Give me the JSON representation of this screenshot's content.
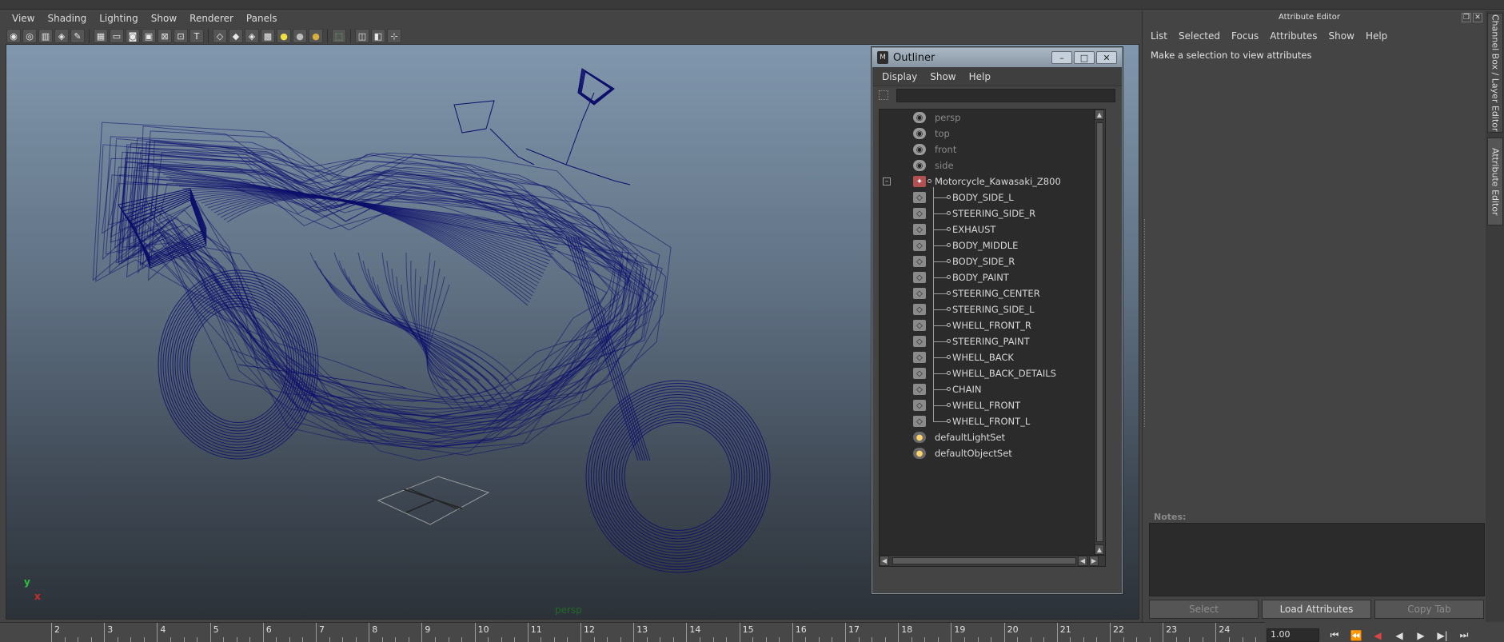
{
  "viewport": {
    "menu": [
      "View",
      "Shading",
      "Lighting",
      "Show",
      "Renderer",
      "Panels"
    ],
    "camera_label": "persp",
    "axis_y": "y",
    "axis_x": "x",
    "wireframe_color": "#0d0f6b"
  },
  "outliner": {
    "title": "Outliner",
    "window_buttons": [
      "–",
      "□",
      "✕"
    ],
    "menu": [
      "Display",
      "Show",
      "Help"
    ],
    "cameras": [
      "persp",
      "top",
      "front",
      "side"
    ],
    "group": "Motorcycle_Kawasaki_Z800",
    "group_expander": "–",
    "children": [
      "BODY_SIDE_L",
      "STEERING_SIDE_R",
      "EXHAUST",
      "BODY_MIDDLE",
      "BODY_SIDE_R",
      "BODY_PAINT",
      "STEERING_CENTER",
      "STEERING_SIDE_L",
      "WHELL_FRONT_R",
      "STEERING_PAINT",
      "WHELL_BACK",
      "WHELL_BACK_DETAILS",
      "CHAIN",
      "WHELL_FRONT",
      "WHELL_FRONT_L"
    ],
    "sets": [
      "defaultLightSet",
      "defaultObjectSet"
    ]
  },
  "attribute_editor": {
    "title": "Attribute Editor",
    "menu": [
      "List",
      "Selected",
      "Focus",
      "Attributes",
      "Show",
      "Help"
    ],
    "message": "Make a selection to view attributes",
    "notes_label": "Notes:",
    "buttons": {
      "select": "Select",
      "load": "Load Attributes",
      "copy": "Copy Tab"
    }
  },
  "side_tabs": [
    "Channel Box / Layer Editor",
    "Attribute Editor"
  ],
  "timeline": {
    "ticks": [
      "2",
      "3",
      "4",
      "5",
      "6",
      "7",
      "8",
      "9",
      "10",
      "11",
      "12",
      "13",
      "14",
      "15",
      "16",
      "17",
      "18",
      "19",
      "20",
      "21",
      "22",
      "23",
      "24"
    ],
    "current_time": "1.00"
  }
}
